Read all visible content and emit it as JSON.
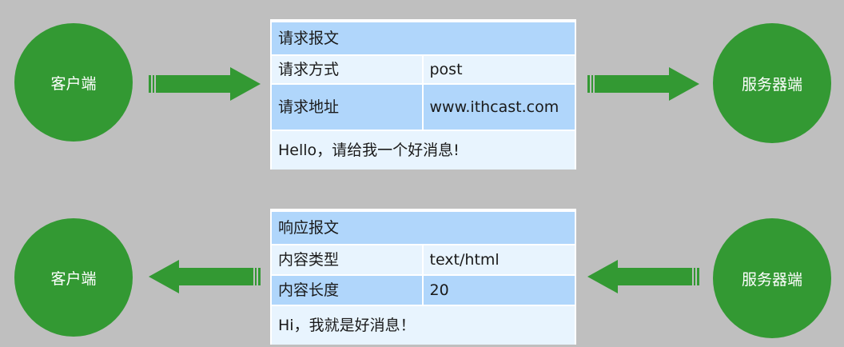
{
  "request": {
    "client_label": "客户端",
    "server_label": "服务器端",
    "title": "请求报文",
    "rows": [
      {
        "key": "请求方式",
        "value": "post"
      },
      {
        "key": "请求地址",
        "value": "www.ithcast.com"
      }
    ],
    "body": "Hello，请给我一个好消息!"
  },
  "response": {
    "client_label": "客户端",
    "server_label": "服务器端",
    "title": "响应报文",
    "rows": [
      {
        "key": "内容类型",
        "value": "text/html"
      },
      {
        "key": "内容长度",
        "value": "20"
      }
    ],
    "body": "Hi，我就是好消息！"
  },
  "colors": {
    "node": "#339933",
    "arrow": "#339933",
    "header": "#b0d6fb",
    "row_light": "#e8f4fe",
    "background": "#bfbfbf"
  }
}
